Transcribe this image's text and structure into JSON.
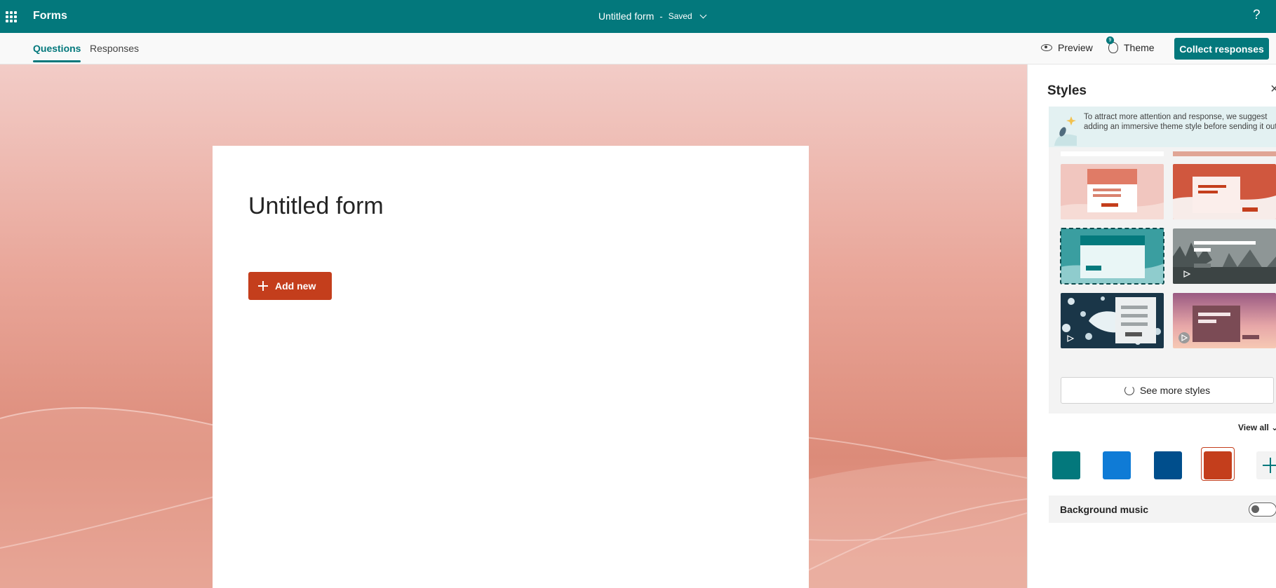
{
  "app": {
    "name": "Forms",
    "help_label": "?"
  },
  "header": {
    "form_title": "Untitled form",
    "separator": "-",
    "status": "Saved"
  },
  "tabs": [
    {
      "label": "Questions",
      "active": true
    },
    {
      "label": "Responses",
      "active": false
    }
  ],
  "commands": {
    "preview": "Preview",
    "theme": "Theme",
    "theme_badge": "9",
    "collect": "Collect responses"
  },
  "form": {
    "title": "Untitled form",
    "add_new": "Add new"
  },
  "styles": {
    "title": "Styles",
    "close_label": "×",
    "tip": "To attract more attention and response, we suggest adding an immersive theme style before sending it out.",
    "see_more": "See more styles",
    "view_all": "View all",
    "thumbnails": [
      {
        "name": "pink-waves",
        "selected": false
      },
      {
        "name": "red-waves",
        "selected": false
      },
      {
        "name": "teal-waves",
        "selected": true
      },
      {
        "name": "misty-forest",
        "selected": false,
        "video": true
      },
      {
        "name": "ice-floes",
        "selected": false,
        "video": true
      },
      {
        "name": "purple-sunset",
        "selected": false,
        "video": true
      }
    ],
    "colors": [
      "#03787c",
      "#0f7bd6",
      "#004e8c",
      "#c43e1c"
    ],
    "selected_color": "#c43e1c",
    "background_music": {
      "label": "Background music",
      "enabled": false
    }
  },
  "colors": {
    "accent": "#03787c",
    "button": "#c43e1c"
  }
}
